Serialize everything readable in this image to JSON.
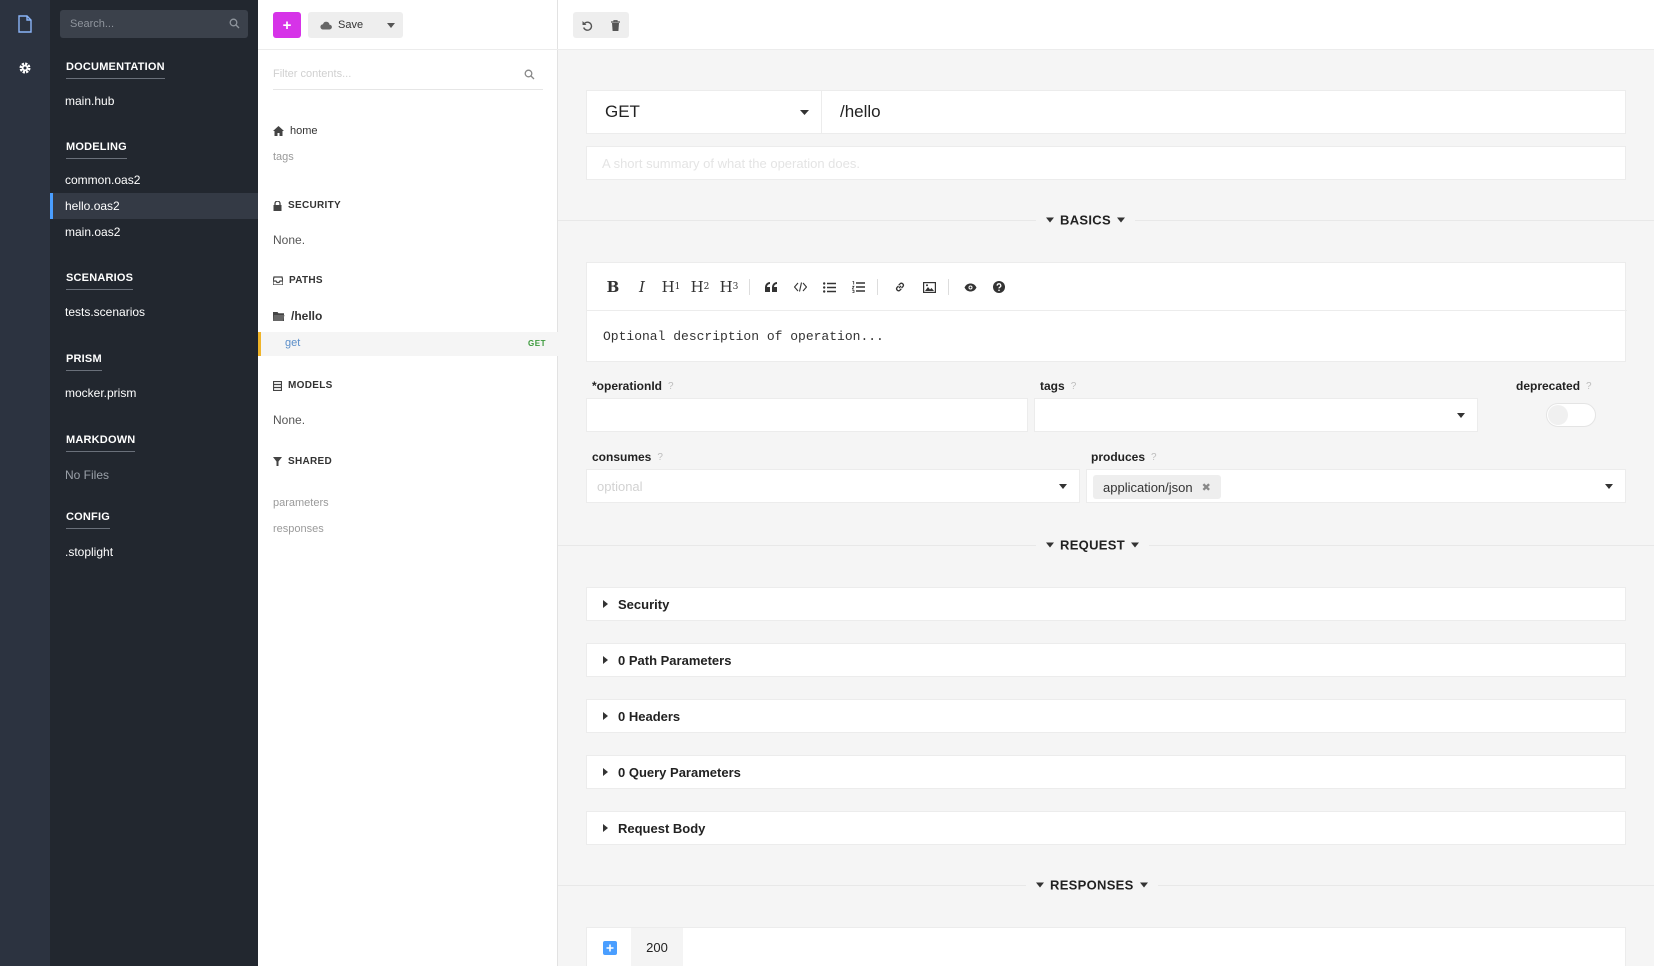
{
  "sidebar": {
    "search_placeholder": "Search...",
    "sections": [
      {
        "title": "DOCUMENTATION",
        "items": [
          {
            "label": "main.hub"
          }
        ]
      },
      {
        "title": "MODELING",
        "items": [
          {
            "label": "common.oas2"
          },
          {
            "label": "hello.oas2",
            "active": true
          },
          {
            "label": "main.oas2"
          }
        ]
      },
      {
        "title": "SCENARIOS",
        "items": [
          {
            "label": "tests.scenarios"
          }
        ]
      },
      {
        "title": "PRISM",
        "items": [
          {
            "label": "mocker.prism"
          }
        ]
      },
      {
        "title": "MARKDOWN",
        "items": [
          {
            "label": "No Files"
          }
        ]
      },
      {
        "title": "CONFIG",
        "items": [
          {
            "label": ".stoplight"
          }
        ]
      }
    ]
  },
  "structure": {
    "add_label": "+",
    "save_label": "Save",
    "filter_placeholder": "Filter contents...",
    "home_label": "home",
    "tags_label": "tags",
    "security_title": "SECURITY",
    "security_value": "None.",
    "paths_title": "PATHS",
    "path_label": "/hello",
    "operation_label": "get",
    "operation_method": "GET",
    "models_title": "MODELS",
    "models_value": "None.",
    "shared_title": "SHARED",
    "shared_items": [
      "parameters",
      "responses"
    ]
  },
  "operation": {
    "method": "GET",
    "path": "/hello",
    "summary_placeholder": "A short summary of what the operation does.",
    "basics_label": "BASICS",
    "description_placeholder": "Optional description of operation...",
    "operation_id_label": "*operationId",
    "operation_id_help": "?",
    "tags_label": "tags",
    "tags_help": "?",
    "deprecated_label": "deprecated",
    "deprecated_help": "?",
    "consumes_label": "consumes",
    "consumes_help": "?",
    "consumes_placeholder": "optional",
    "produces_label": "produces",
    "produces_help": "?",
    "produces_value": "application/json",
    "request_label": "REQUEST",
    "request_panels": [
      "Security",
      "0 Path Parameters",
      "0 Headers",
      "0 Query Parameters",
      "Request Body"
    ],
    "responses_label": "RESPONSES",
    "response_code": "200"
  },
  "editor_toolbar": {
    "bold": "B",
    "italic": "I",
    "h": "H",
    "h1": "1",
    "h2": "2",
    "h3": "3"
  },
  "colors": {
    "accent_add": "#d633e8",
    "active_file_bar": "#4a9eff",
    "active_operation_bar": "#f0b429",
    "get_method": "#3c9a3c"
  },
  "icons": [
    "document-icon",
    "gear-icon",
    "search-icon",
    "cloud-icon",
    "caret-down-icon",
    "undo-icon",
    "trash-icon",
    "home-icon",
    "lock-icon",
    "inbox-icon",
    "folder-icon",
    "table-icon",
    "filter-icon",
    "quote-icon",
    "code-icon",
    "list-icon",
    "ordered-list-icon",
    "link-icon",
    "image-icon",
    "eye-icon",
    "help-icon",
    "plus-square-icon"
  ]
}
